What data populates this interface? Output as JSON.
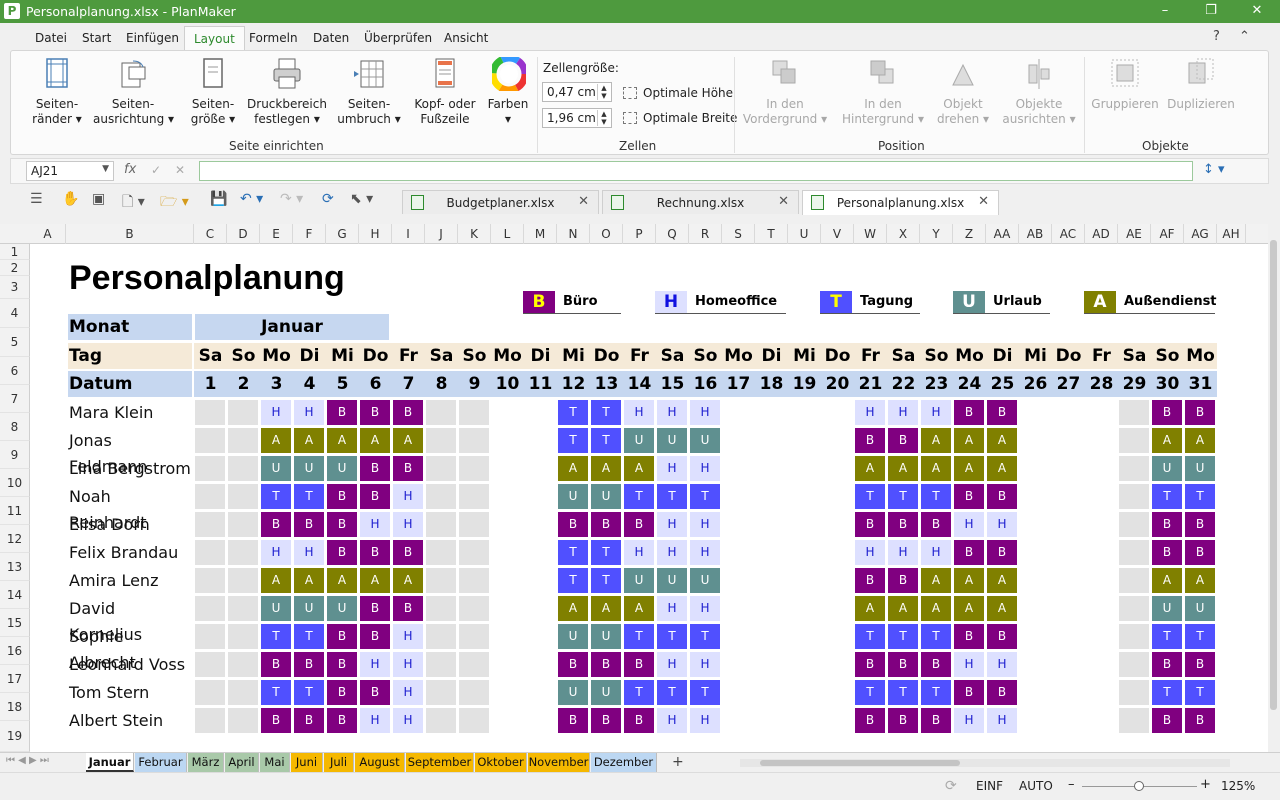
{
  "window": {
    "title": "Personalplanung.xlsx - PlanMaker",
    "app_icon": "P",
    "minimize": "–",
    "maximize": "❐",
    "close": "✕"
  },
  "menu": {
    "items": [
      "Datei",
      "Start",
      "Einfügen",
      "Layout",
      "Formeln",
      "Daten",
      "Überprüfen",
      "Ansicht"
    ],
    "active": "Layout",
    "help": "?",
    "collapse": "⌃"
  },
  "ribbon": {
    "groups": {
      "seite": "Seite einrichten",
      "zellen": "Zellen",
      "position": "Position",
      "objekte": "Objekte"
    },
    "seitenraender": "Seiten-\nränder ▾",
    "seitenausrichtung": "Seiten-\nausrichtung ▾",
    "seitengroesse": "Seiten-\ngröße ▾",
    "druckbereich": "Druckbereich\nfestlegen ▾",
    "seitenumbruch": "Seiten-\numbruch ▾",
    "kopf": "Kopf- oder\nFußzeile",
    "farben": "Farben\n▾",
    "zellgroesse_label": "Zellengröße:",
    "hoehe_value": "0,47 cm",
    "breite_value": "1,96 cm",
    "optimale_hoehe": "Optimale Höhe",
    "optimale_breite": "Optimale Breite",
    "vordergrund": "In den\nVordergrund ▾",
    "hintergrund": "In den\nHintergrund ▾",
    "drehen": "Objekt\ndrehen ▾",
    "ausrichten": "Objekte\nausrichten ▾",
    "gruppieren": "Gruppieren",
    "duplizieren": "Duplizieren"
  },
  "formula_bar": {
    "cell_ref": "AJ21",
    "fx": "fx",
    "confirm": "✓",
    "cancel": "✕",
    "value": ""
  },
  "doc_tabs": [
    {
      "label": "Budgetplaner.xlsx",
      "close": "✕"
    },
    {
      "label": "Rechnung.xlsx",
      "close": "✕"
    },
    {
      "label": "Personalplanung.xlsx",
      "close": "✕"
    }
  ],
  "columns": [
    "A",
    "B",
    "C",
    "D",
    "E",
    "F",
    "G",
    "H",
    "I",
    "J",
    "K",
    "L",
    "M",
    "N",
    "O",
    "P",
    "Q",
    "R",
    "S",
    "T",
    "U",
    "V",
    "W",
    "X",
    "Y",
    "Z",
    "AA",
    "AB",
    "AC",
    "AD",
    "AE",
    "AF",
    "AG",
    "AH"
  ],
  "rows": [
    "1",
    "2",
    "3",
    "4",
    "5",
    "6",
    "7",
    "8",
    "9",
    "10",
    "11",
    "12",
    "13",
    "14",
    "15",
    "16",
    "17",
    "18",
    "19"
  ],
  "sheet": {
    "title": "Personalplanung",
    "legend": [
      {
        "code": "B",
        "label": "Büro",
        "bg": "#800080",
        "fg": "#ffff00"
      },
      {
        "code": "H",
        "label": "Homeoffice",
        "bg": "#dde0ff",
        "fg": "#1010e0"
      },
      {
        "code": "T",
        "label": "Tagung",
        "bg": "#5050ff",
        "fg": "#ffff00"
      },
      {
        "code": "U",
        "label": "Urlaub",
        "bg": "#5f9090",
        "fg": "#ffffff"
      },
      {
        "code": "A",
        "label": "Außendienst",
        "bg": "#808000",
        "fg": "#ffffff"
      }
    ],
    "monat_label": "Monat",
    "monat": "Januar",
    "tag_label": "Tag",
    "datum_label": "Datum",
    "weekdays": [
      "Sa",
      "So",
      "Mo",
      "Di",
      "Mi",
      "Do",
      "Fr",
      "Sa",
      "So",
      "Mo",
      "Di",
      "Mi",
      "Do",
      "Fr",
      "Sa",
      "So",
      "Mo",
      "Di",
      "Mi",
      "Do",
      "Fr",
      "Sa",
      "So",
      "Mo",
      "Di",
      "Mi",
      "Do",
      "Fr",
      "Sa",
      "So",
      "Mo"
    ],
    "dates": [
      "1",
      "2",
      "3",
      "4",
      "5",
      "6",
      "7",
      "8",
      "9",
      "10",
      "11",
      "12",
      "13",
      "14",
      "15",
      "16",
      "17",
      "18",
      "19",
      "20",
      "21",
      "22",
      "23",
      "24",
      "25",
      "26",
      "27",
      "28",
      "29",
      "30",
      "31"
    ],
    "employees": [
      {
        "name": "Mara Klein",
        "schedule": "..HHBBB....TTHHH....HHHBB....BBBBB..H"
      },
      {
        "name": "Jonas Feldmann",
        "schedule": "..AAAAA....TTUUU....BBAAA....AAAAA..B"
      },
      {
        "name": "Lina Bergstrom",
        "schedule": "..UUUBB....AAAHH....AAAAA....UUUUU..A"
      },
      {
        "name": "Noah Reinhardt",
        "schedule": "..TTBBH....UUTTT....TTTBB....TTBHH..T"
      },
      {
        "name": "Elisa Dorn",
        "schedule": "..BBBHH....BBBHH....BBBHH....BBBUU..B"
      },
      {
        "name": "Felix Brandau",
        "schedule": "..HHBBB....TTHHH....HHHBB....BBBBB..H"
      },
      {
        "name": "Amira Lenz",
        "schedule": "..AAAAA....TTUUU....BBAAA....AAAAA..B"
      },
      {
        "name": "David Kornelius",
        "schedule": "..UUUBB....AAAHH....AAAAA....UUUUU..A"
      },
      {
        "name": "Sophie Albrecht",
        "schedule": "..TTBBH....UUTTT....TTTBB....TTBHH..T"
      },
      {
        "name": "Leonhard Voss",
        "schedule": "..BBBHH....BBBHH....BBBHH....BBBUU..B"
      },
      {
        "name": "Tom Stern",
        "schedule": "..TTBBH....UUTTT....TTTBB....TTBHH..T"
      },
      {
        "name": "Albert Stein",
        "schedule": "..BBBHH....BBBHH....BBBHH....BBBUU..B"
      }
    ]
  },
  "sheet_tabs": [
    {
      "label": "Januar",
      "color": "#ffffff"
    },
    {
      "label": "Februar",
      "color": "#bcd7f2"
    },
    {
      "label": "März",
      "color": "#a9c9a9"
    },
    {
      "label": "April",
      "color": "#a9c9a9"
    },
    {
      "label": "Mai",
      "color": "#a9c9a9"
    },
    {
      "label": "Juni",
      "color": "#f5b800"
    },
    {
      "label": "Juli",
      "color": "#f5b800"
    },
    {
      "label": "August",
      "color": "#f5b800"
    },
    {
      "label": "September",
      "color": "#f5b800"
    },
    {
      "label": "Oktober",
      "color": "#f5b800"
    },
    {
      "label": "November",
      "color": "#f5b800"
    },
    {
      "label": "Dezember",
      "color": "#bcd7f2"
    }
  ],
  "add_sheet": "+",
  "status": {
    "mode": "EINF",
    "calc": "AUTO",
    "zoom": "125%",
    "zoom_minus": "–",
    "zoom_plus": "+"
  }
}
